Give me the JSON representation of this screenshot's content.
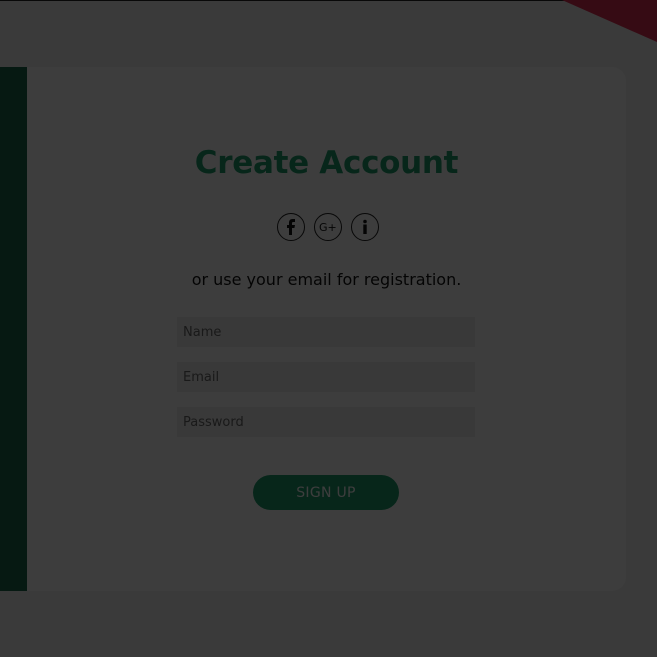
{
  "page": {
    "title": "Create Account",
    "subtitle": "or use your email for registration."
  },
  "social": [
    {
      "name": "facebook-icon",
      "glyph": "f"
    },
    {
      "name": "google-plus-icon",
      "glyph": "G+"
    },
    {
      "name": "linkedin-icon",
      "glyph": "in"
    }
  ],
  "form": {
    "name_placeholder": "Name",
    "email_placeholder": "Email",
    "password_placeholder": "Password",
    "signup_label": "SIGN UP"
  },
  "colors": {
    "accent": "#1f9d6c",
    "side_panel": "#1b6b4d",
    "corner_shape": "#e03054",
    "overlay": "rgba(0,0,0,0.76)"
  }
}
